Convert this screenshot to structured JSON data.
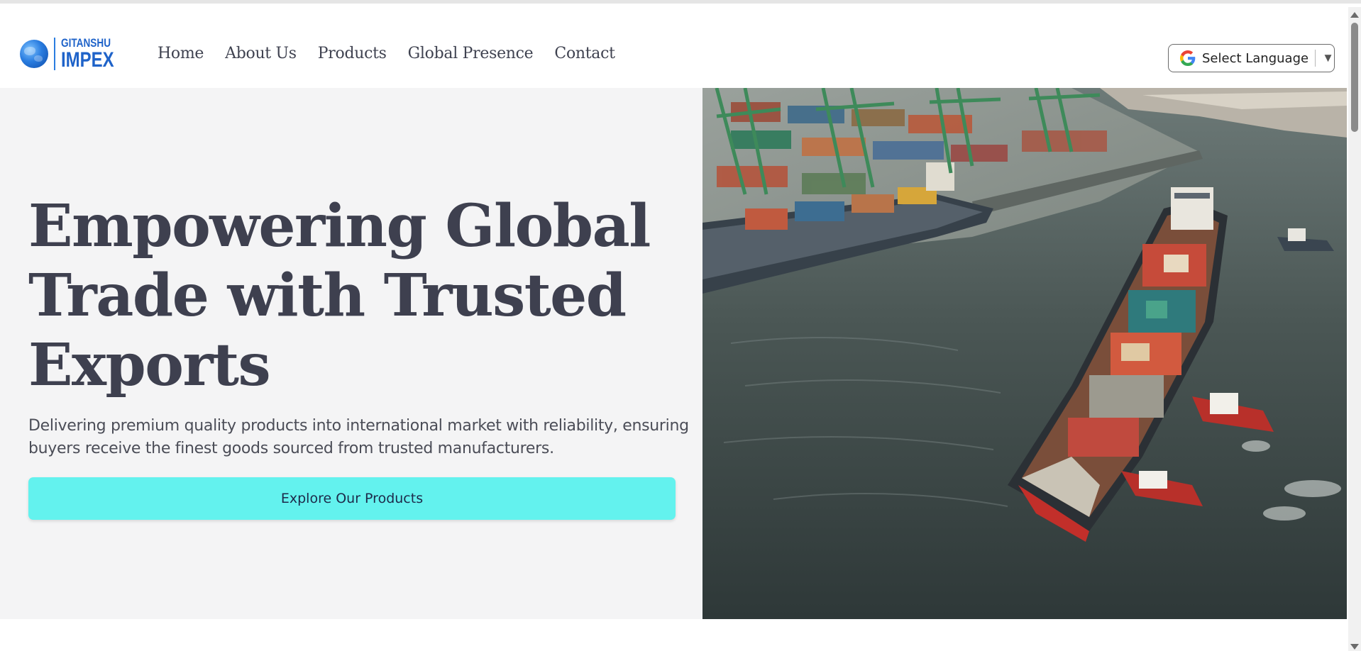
{
  "header": {
    "logo": {
      "top_text": "GITANSHU",
      "bottom_text": "IMPEX",
      "icon": "globe-icon",
      "color": "#1f63c9"
    },
    "nav": [
      {
        "label": "Home"
      },
      {
        "label": "About Us"
      },
      {
        "label": "Products"
      },
      {
        "label": "Global Presence"
      },
      {
        "label": "Contact"
      }
    ],
    "language_select": {
      "label": "Select Language",
      "icon": "google-icon",
      "arrow": "▼"
    }
  },
  "hero": {
    "title": "Empowering Global Trade with Trusted Exports",
    "subtitle": "Delivering premium quality products into international market with reliability, ensuring buyers receive the finest goods sourced from trusted manufacturers.",
    "cta_label": "Explore Our Products",
    "cta_color": "#63f2ee",
    "image": "aerial photo of container ship with tugboats at port with cranes"
  },
  "colors": {
    "text_dark": "#3e404f",
    "hero_bg": "#f4f4f5",
    "water": "#3c4a4a"
  }
}
